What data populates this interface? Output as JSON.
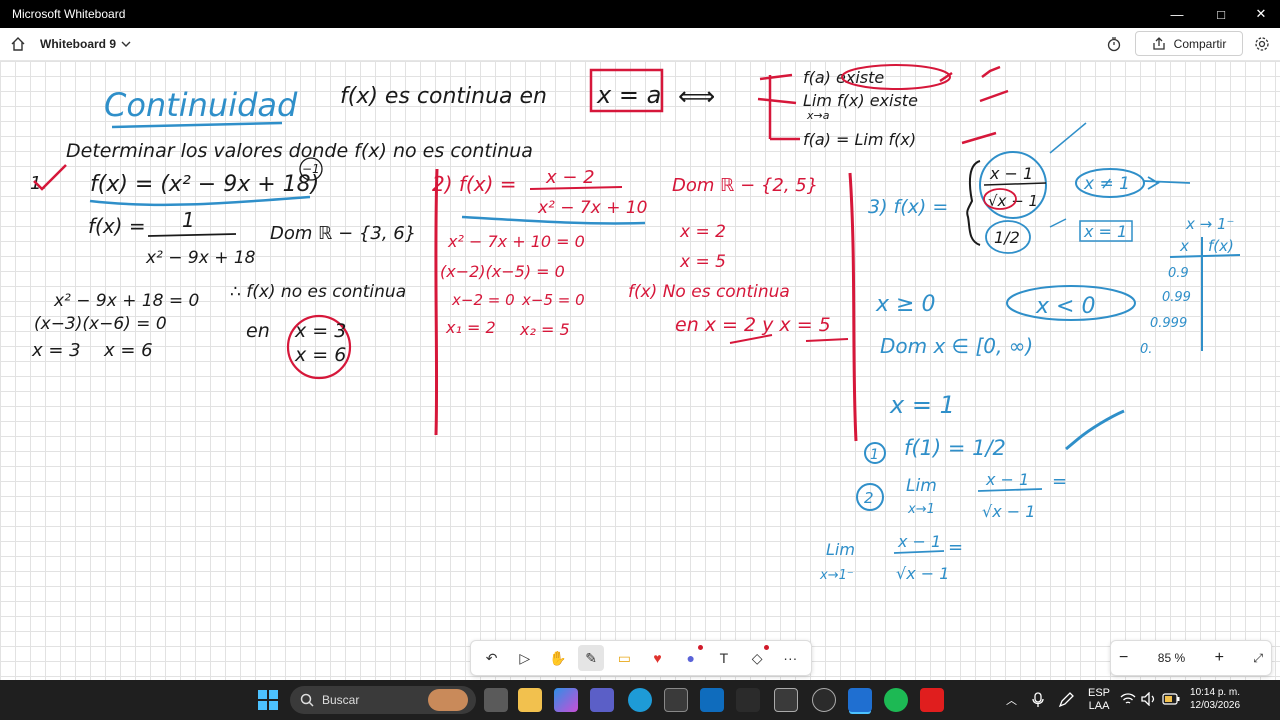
{
  "window": {
    "title": "Microsoft Whiteboard",
    "minimize": "—",
    "maximize": "□",
    "close": "✕"
  },
  "appbar": {
    "board_name": "Whiteboard 9",
    "share_label": "Compartir"
  },
  "ink": {
    "heading": "Continuidad",
    "definition": {
      "lhs": "f(x) es continua en",
      "boxed": "x = a",
      "iff": "⟺"
    },
    "conditions": [
      "f(a) existe",
      "Lim f(x) existe",
      "f(a) = Lim f(x)"
    ],
    "limit_sub": "x→a",
    "task": "Determinar los valores donde f(x) no es continua",
    "ex1": {
      "num": "1.",
      "fx": "f(x) = (x² − 9x + 18)",
      "exp": "−1",
      "frac_lhs": "f(x) =",
      "frac_num": "1",
      "frac_den": "x² − 9x + 18",
      "dom": "Dom ℝ − {3, 6}",
      "eq": "x² − 9x + 18 = 0",
      "factored": "(x−3)(x−6) = 0",
      "x1": "x = 3",
      "x2": "x = 6",
      "conclusion": "∴ f(x) no es continua",
      "en": "en",
      "circled1": "x = 3",
      "circled2": "x = 6"
    },
    "ex2": {
      "lhs": "2) f(x) =",
      "num": "x − 2",
      "den": "x² − 7x + 10",
      "dom": "Dom ℝ − {2, 5}",
      "eq": "x² − 7x + 10 = 0",
      "factored": "(x−2)(x−5) = 0",
      "f1": "x−2 = 0",
      "f2": "x−5 = 0",
      "r1": "x₁ = 2",
      "r2": "x₂ = 5",
      "s1": "x = 2",
      "s2": "x = 5",
      "concl1": "f(x) No es continua",
      "concl2": "en x = 2 y x = 5"
    },
    "ex3": {
      "lhs": "3) f(x) =",
      "piece1_num": "x − 1",
      "piece1_den": "√x − 1",
      "piece2": "1/2",
      "cond1": "x ≠ 1",
      "cond2": "x = 1",
      "x_geq": "x ≥ 0",
      "x_lt": "x < 0",
      "dom": "Dom x ∈ [0, ∞)",
      "x_eq": "x = 1",
      "step1_mark": "1",
      "step1": "f(1) = 1/2",
      "step2_mark": "2",
      "step2_lim": "Lim",
      "step2_sub": "x→1",
      "step2_num": "x − 1",
      "step2_den": "√x − 1",
      "step2_eq": "=",
      "step3_lim": "Lim",
      "step3_sub": "x→1⁻",
      "step3_num": "x − 1",
      "step3_den": "√x − 1",
      "step3_eq": "=",
      "table_head": "x → 1⁻",
      "table_col1": "x",
      "table_col2": "f(x)",
      "table_vals": [
        "0.9",
        "0.99",
        "0.999",
        "0."
      ]
    }
  },
  "toolbar": {
    "undo": "↶",
    "select": "▷",
    "pan": "✋",
    "pen": "✎",
    "note": "▭",
    "reaction": "♥",
    "chat": "●",
    "text": "T",
    "shapes": "◇",
    "more": "···"
  },
  "zoom": {
    "out": "−",
    "level": "85 %",
    "in": "+",
    "fit": "⤢"
  },
  "taskbar": {
    "search_placeholder": "Buscar",
    "lang1": "ESP",
    "lang2": "LAA",
    "time": "10:14 p. m.",
    "date": "12/03/2026"
  },
  "colors": {
    "red_ink": "#d6173a",
    "blue_ink": "#2f8fc9",
    "black_ink": "#1a1a1a"
  }
}
